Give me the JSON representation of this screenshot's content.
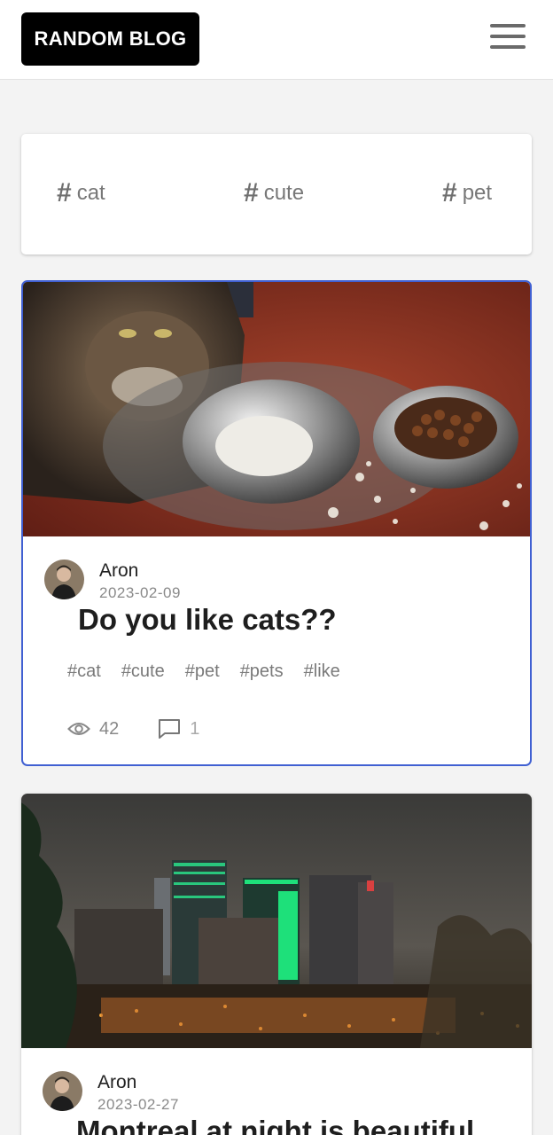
{
  "header": {
    "logo": "RANDOM BLOG",
    "menu_icon": "hamburger-menu-icon"
  },
  "popular_tags": [
    {
      "label": "cat",
      "icon": "hash-icon"
    },
    {
      "label": "cute",
      "icon": "hash-icon"
    },
    {
      "label": "pet",
      "icon": "hash-icon"
    }
  ],
  "posts": [
    {
      "author": "Aron",
      "date": "2023-02-09",
      "title": "Do you like cats??",
      "tags": [
        "#cat",
        "#cute",
        "#pet",
        "#pets",
        "#like"
      ],
      "views": "42",
      "comments": "1"
    },
    {
      "author": "Aron",
      "date": "2023-02-27",
      "title": "Montreal at night is beautiful"
    }
  ],
  "colors": {
    "accent_border": "#4060d2",
    "logo_bg": "#000000"
  }
}
